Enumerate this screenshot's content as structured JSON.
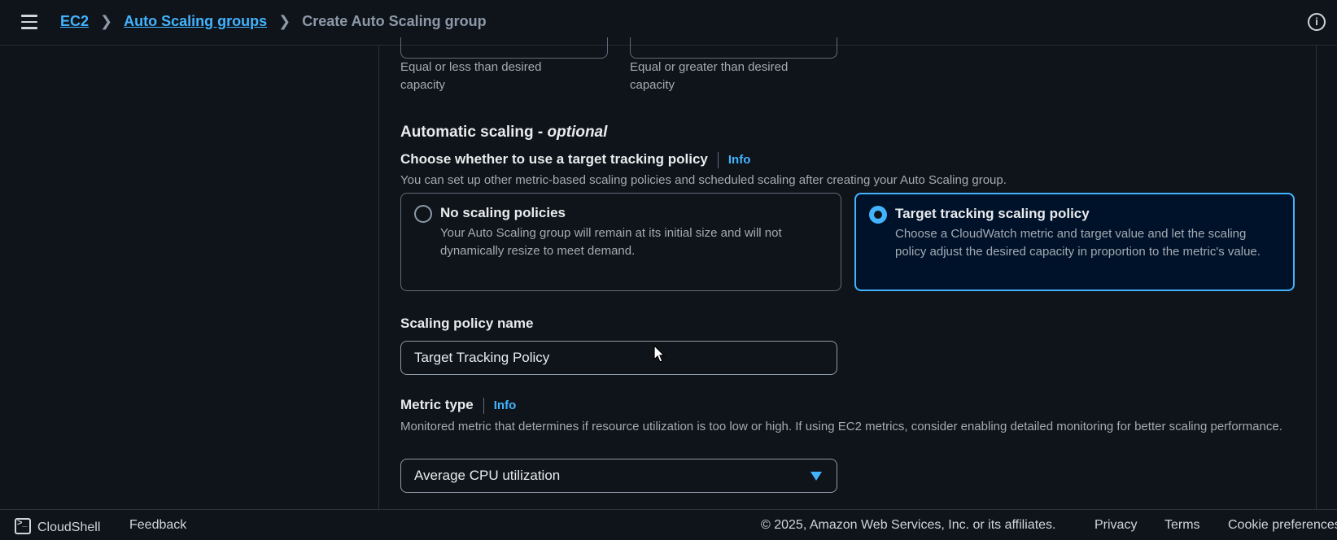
{
  "breadcrumb": {
    "items": [
      "EC2",
      "Auto Scaling groups"
    ],
    "current": "Create Auto Scaling group"
  },
  "capacity_hints": {
    "min": "Equal or less than desired capacity",
    "max": "Equal or greater than desired capacity"
  },
  "scaling": {
    "title": "Automatic scaling - ",
    "title_suffix": "optional",
    "question": "Choose whether to use a target tracking policy",
    "info": "Info",
    "description": "You can set up other metric-based scaling policies and scheduled scaling after creating your Auto Scaling group.",
    "options": [
      {
        "title": "No scaling policies",
        "description": "Your Auto Scaling group will remain at its initial size and will not dynamically resize to meet demand.",
        "selected": false
      },
      {
        "title": "Target tracking scaling policy",
        "description": "Choose a CloudWatch metric and target value and let the scaling policy adjust the desired capacity in proportion to the metric's value.",
        "selected": true
      }
    ]
  },
  "policy_name": {
    "label": "Scaling policy name",
    "value": "Target Tracking Policy"
  },
  "metric_type": {
    "label": "Metric type",
    "info": "Info",
    "description": "Monitored metric that determines if resource utilization is too low or high. If using EC2 metrics, consider enabling detailed monitoring for better scaling performance.",
    "selected": "Average CPU utilization"
  },
  "footer": {
    "cloudshell": "CloudShell",
    "feedback": "Feedback",
    "copyright": "© 2025, Amazon Web Services, Inc. or its affiliates.",
    "privacy": "Privacy",
    "terms": "Terms",
    "cookies": "Cookie preferences"
  },
  "colors": {
    "accent": "#42b4ff",
    "background": "#0f141a",
    "selected_tile_bg": "#001229"
  }
}
